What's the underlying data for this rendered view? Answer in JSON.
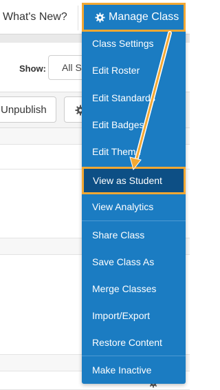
{
  "topbar": {
    "whats_new": "What's New?"
  },
  "filter": {
    "show_label": "Show:",
    "show_value": "All S"
  },
  "toolbar": {
    "unpublish_label": "Unpublish",
    "gear_icon": "gear-icon"
  },
  "manage_button": {
    "label": "Manage Class",
    "icon": "gear-icon"
  },
  "menu": {
    "items": [
      {
        "label": "Class Settings"
      },
      {
        "label": "Edit Roster"
      },
      {
        "label": "Edit Standards"
      },
      {
        "label": "Edit Badges"
      },
      {
        "label": "Edit Theme"
      },
      {
        "label": "View as Student",
        "highlighted": true
      },
      {
        "label": "View Analytics"
      },
      {
        "label": "Share Class"
      },
      {
        "label": "Save Class As"
      },
      {
        "label": "Merge Classes"
      },
      {
        "label": "Import/Export"
      },
      {
        "label": "Restore Content"
      },
      {
        "label": "Make Inactive"
      }
    ]
  },
  "colors": {
    "menu_blue": "#1b7cc2",
    "highlight_blue": "#0d4f85",
    "callout_orange": "#f3a833"
  }
}
